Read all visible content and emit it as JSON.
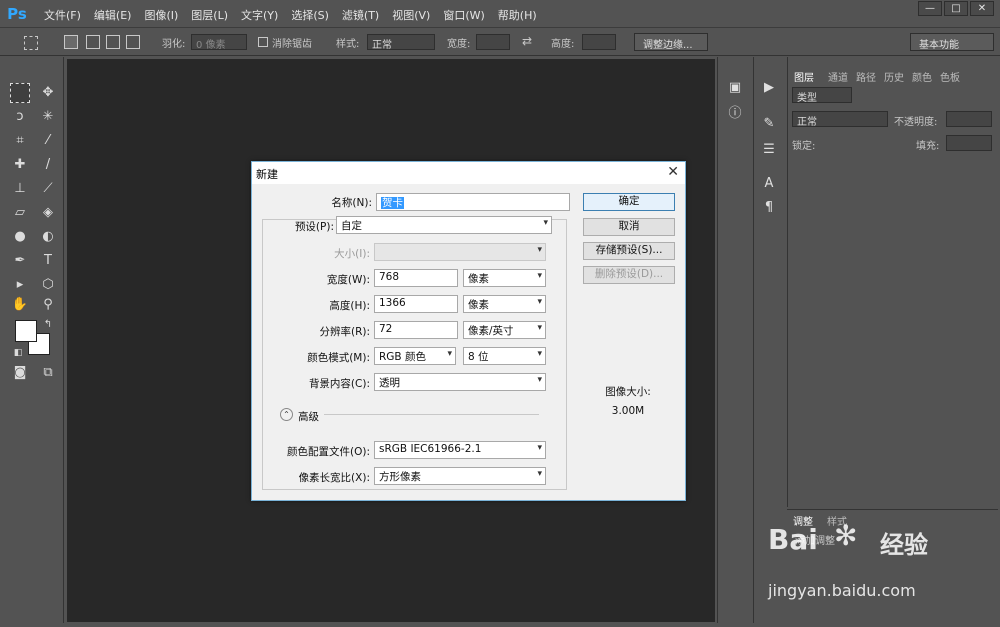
{
  "app": {
    "logo": "Ps"
  },
  "menu": [
    "文件(F)",
    "编辑(E)",
    "图像(I)",
    "图层(L)",
    "文字(Y)",
    "选择(S)",
    "滤镜(T)",
    "视图(V)",
    "窗口(W)",
    "帮助(H)"
  ],
  "window_controls": {
    "minimize": "—",
    "maximize": "□",
    "close": "✕"
  },
  "options_bar": {
    "feather_label": "羽化:",
    "feather_value": "0 像素",
    "antialias_label": "消除锯齿",
    "style_label": "样式:",
    "style_value": "正常",
    "width_label": "宽度:",
    "height_label": "高度:",
    "refine_button": "调整边缘...",
    "workspace": "基本功能"
  },
  "layers_panel": {
    "tabs": [
      "图层",
      "通道",
      "路径",
      "历史",
      "颜色",
      "色板"
    ],
    "filter_type": "类型",
    "blend_mode": "正常",
    "opacity_label": "不透明度:",
    "lock_label": "锁定:",
    "fill_label": "填充:"
  },
  "adjust_panel": {
    "tabs": [
      "调整",
      "样式"
    ],
    "hint": "添加调整"
  },
  "dialog": {
    "title": "新建",
    "close": "✕",
    "name_label": "名称(N):",
    "name_value": "贺卡",
    "preset_label": "预设(P):",
    "preset_value": "自定",
    "size_label": "大小(I):",
    "width_label": "宽度(W):",
    "width_value": "768",
    "width_unit": "像素",
    "height_label": "高度(H):",
    "height_value": "1366",
    "height_unit": "像素",
    "resolution_label": "分辨率(R):",
    "resolution_value": "72",
    "resolution_unit": "像素/英寸",
    "color_mode_label": "颜色模式(M):",
    "color_mode_value": "RGB 颜色",
    "bit_depth_value": "8 位",
    "background_label": "背景内容(C):",
    "background_value": "透明",
    "advanced_label": "高级",
    "color_profile_label": "颜色配置文件(O):",
    "color_profile_value": "sRGB IEC61966-2.1",
    "pixel_aspect_label": "像素长宽比(X):",
    "pixel_aspect_value": "方形像素",
    "ok_button": "确定",
    "cancel_button": "取消",
    "save_preset_button": "存储预设(S)...",
    "delete_preset_button": "删除预设(D)...",
    "image_size_label": "图像大小:",
    "image_size_value": "3.00M"
  },
  "watermark": {
    "brand": "Bai",
    "brand_cn": "经验",
    "url": "jingyan.baidu.com"
  },
  "colors": {
    "ps_blue": "#31a8ff",
    "dialog_bg": "#f0f0f0",
    "selection": "#3399ff",
    "canvas": "#282828"
  }
}
